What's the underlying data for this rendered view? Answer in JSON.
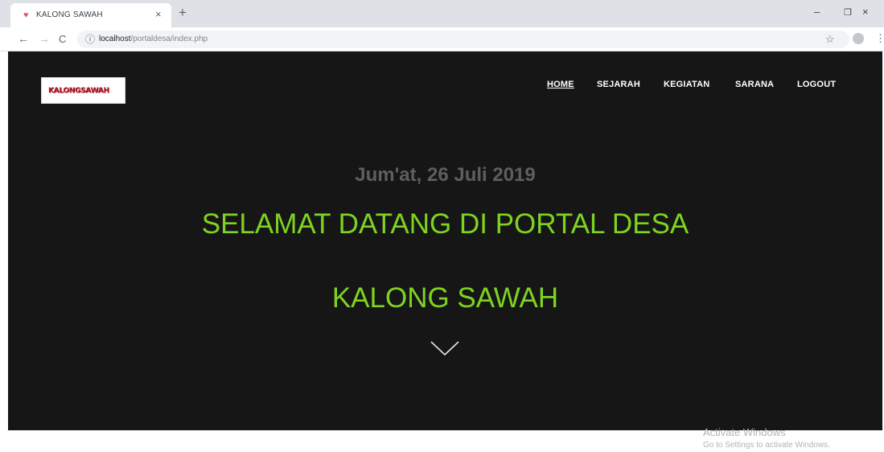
{
  "browser": {
    "tab": {
      "favicon": "heart-icon",
      "title": "KALONG SAWAH",
      "close_glyph": "×"
    },
    "new_tab_glyph": "+",
    "window_controls": {
      "minimize_glyph": "–",
      "maximize_glyph": "❐",
      "close_glyph": "×"
    },
    "toolbar": {
      "back_glyph": "←",
      "forward_glyph": "→",
      "reload_glyph": "C",
      "info_glyph": "ⓘ",
      "url_host": "localhost",
      "url_path": "/portaldesa/index.php",
      "star_glyph": "☆",
      "menu_glyph": "⋮"
    }
  },
  "site": {
    "logo_text": "KALONGSAWAH",
    "nav": {
      "home": "HOME",
      "sejarah": "SEJARAH",
      "kegiatan": "KEGIATAN",
      "sarana": "SARANA",
      "logout": "LOGOUT"
    },
    "active_nav": "HOME",
    "date": "Jum'at, 26 Juli 2019",
    "headline_line1": "SELAMAT DATANG DI PORTAL DESA",
    "headline_line2": "KALONG SAWAH",
    "colors": {
      "background": "#161616",
      "headline": "#7ed321",
      "date": "#5e5e5e",
      "nav_text": "#ffffff"
    }
  },
  "watermark": {
    "line1": "Activate Windows",
    "line2": "Go to Settings to activate Windows."
  }
}
